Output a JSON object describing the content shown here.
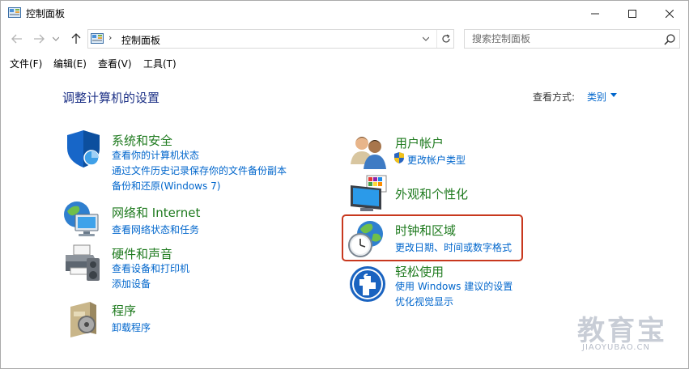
{
  "window": {
    "title": "控制面板"
  },
  "addressbar": {
    "path": "控制面板",
    "separator": "›"
  },
  "search": {
    "placeholder": "搜索控制面板"
  },
  "menu": [
    "文件(F)",
    "编辑(E)",
    "查看(V)",
    "工具(T)"
  ],
  "main": {
    "title": "调整计算机的设置",
    "view_by_label": "查看方式:",
    "view_by_value": "类别"
  },
  "categories": {
    "system": {
      "title": "系统和安全",
      "links": [
        "查看你的计算机状态",
        "通过文件历史记录保存你的文件备份副本",
        "备份和还原(Windows 7)"
      ]
    },
    "network": {
      "title": "网络和 Internet",
      "links": [
        "查看网络状态和任务"
      ]
    },
    "hardware": {
      "title": "硬件和声音",
      "links": [
        "查看设备和打印机",
        "添加设备"
      ]
    },
    "programs": {
      "title": "程序",
      "links": [
        "卸载程序"
      ]
    },
    "users": {
      "title": "用户帐户",
      "links": [
        "更改帐户类型"
      ]
    },
    "appearance": {
      "title": "外观和个性化",
      "links": []
    },
    "clock": {
      "title": "时钟和区域",
      "links": [
        "更改日期、时间或数字格式"
      ]
    },
    "ease": {
      "title": "轻松使用",
      "links": [
        "使用 Windows 建议的设置",
        "优化视觉显示"
      ]
    }
  },
  "watermark": {
    "big": "教育宝",
    "small": "JIAOYUBAO.CN"
  },
  "colors": {
    "link": "#0066cc",
    "category": "#1e7a1e",
    "title": "#1e3287",
    "highlight": "#c8381e"
  }
}
